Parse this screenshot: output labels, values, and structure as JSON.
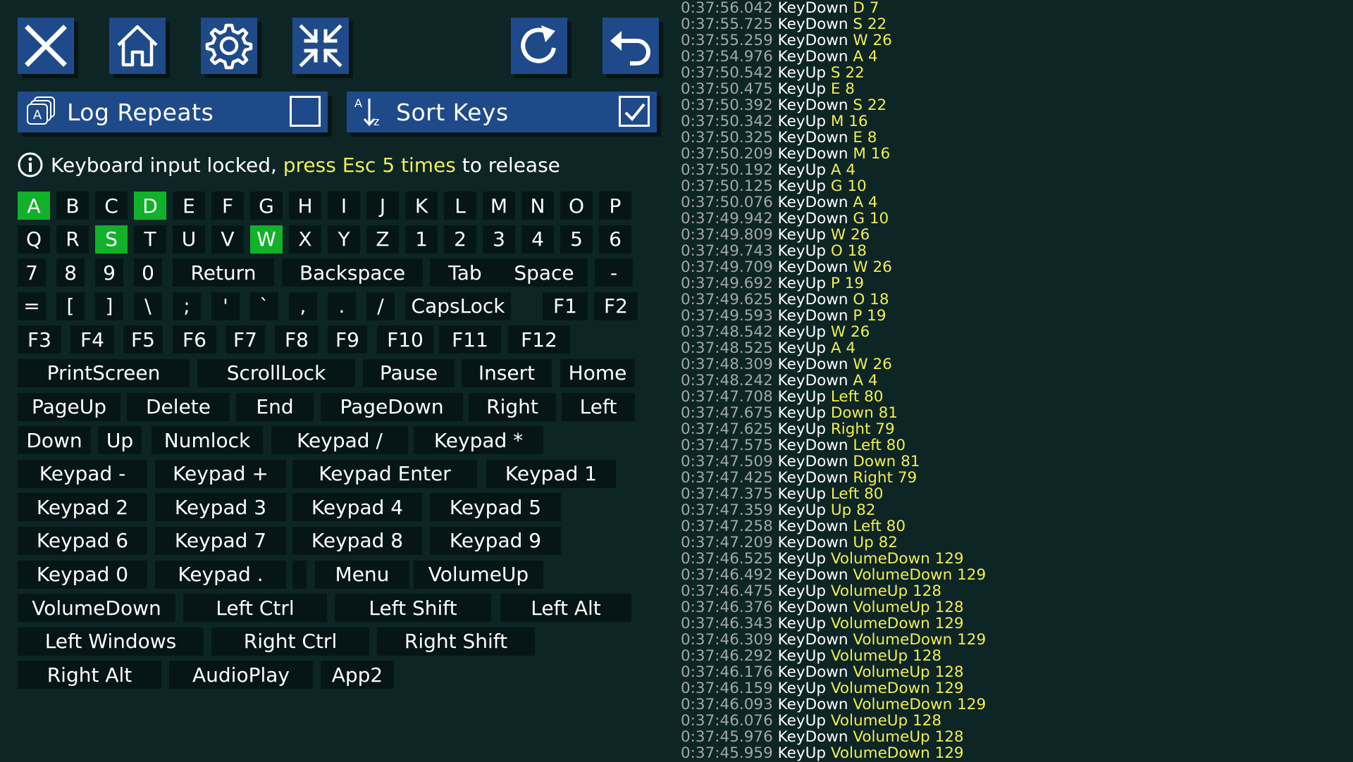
{
  "toolbar": [
    {
      "name": "close-button",
      "icon": "close-icon",
      "x": 0
    },
    {
      "name": "home-button",
      "icon": "home-icon",
      "x": 0
    },
    {
      "name": "settings-button",
      "icon": "gear-icon",
      "x": 0
    },
    {
      "name": "minimize-button",
      "icon": "collapse-icon",
      "x": 0
    },
    {
      "name": "reload-button",
      "icon": "redo-icon",
      "x": 0
    },
    {
      "name": "back-button",
      "icon": "undo-icon",
      "x": 0
    }
  ],
  "toggles": {
    "log_repeats": {
      "label": "Log Repeats",
      "checked": false,
      "icon": "keys-stack-icon"
    },
    "sort_keys": {
      "label": "Sort Keys",
      "checked": true,
      "icon": "sort-az-icon"
    }
  },
  "info": {
    "icon": "info-icon",
    "prefix": "Keyboard input locked, ",
    "highlight": "press Esc 5 times",
    "suffix": " to release"
  },
  "keyboard": {
    "rows": [
      [
        {
          "label": "A",
          "down": true
        },
        {
          "label": "B"
        },
        {
          "label": "C"
        },
        {
          "label": "D",
          "down": true
        },
        {
          "label": "E"
        },
        {
          "label": "F"
        },
        {
          "label": "G"
        },
        {
          "label": "H"
        },
        {
          "label": "I"
        },
        {
          "label": "J"
        },
        {
          "label": "K"
        },
        {
          "label": "L"
        },
        {
          "label": "M"
        },
        {
          "label": "N"
        },
        {
          "label": "O"
        },
        {
          "label": "P"
        }
      ],
      [
        {
          "label": "Q"
        },
        {
          "label": "R"
        },
        {
          "label": "S",
          "down": true
        },
        {
          "label": "T"
        },
        {
          "label": "U"
        },
        {
          "label": "V"
        },
        {
          "label": "W",
          "down": true
        },
        {
          "label": "X"
        },
        {
          "label": "Y"
        },
        {
          "label": "Z"
        },
        {
          "label": "1"
        },
        {
          "label": "2"
        },
        {
          "label": "3"
        },
        {
          "label": "4"
        },
        {
          "label": "5"
        },
        {
          "label": "6"
        }
      ],
      [
        {
          "label": "7"
        },
        {
          "label": "8"
        },
        {
          "label": "9"
        },
        {
          "label": "0"
        },
        {
          "label": "Return"
        },
        {
          "label": "Backspace"
        },
        {
          "label": "Tab"
        },
        {
          "label": "Space"
        },
        {
          "label": "-"
        }
      ],
      [
        {
          "label": "="
        },
        {
          "label": "["
        },
        {
          "label": "]"
        },
        {
          "label": "\\"
        },
        {
          "label": ";"
        },
        {
          "label": "'"
        },
        {
          "label": "`"
        },
        {
          "label": ","
        },
        {
          "label": "."
        },
        {
          "label": "/"
        },
        {
          "label": "CapsLock"
        },
        {
          "label": "F1"
        },
        {
          "label": "F2"
        }
      ],
      [
        {
          "label": "F3"
        },
        {
          "label": "F4"
        },
        {
          "label": "F5"
        },
        {
          "label": "F6"
        },
        {
          "label": "F7"
        },
        {
          "label": "F8"
        },
        {
          "label": "F9"
        },
        {
          "label": "F10"
        },
        {
          "label": "F11"
        },
        {
          "label": "F12"
        }
      ],
      [
        {
          "label": "PrintScreen"
        },
        {
          "label": "ScrollLock"
        },
        {
          "label": "Pause"
        },
        {
          "label": "Insert"
        },
        {
          "label": "Home"
        }
      ],
      [
        {
          "label": "PageUp"
        },
        {
          "label": "Delete"
        },
        {
          "label": "End"
        },
        {
          "label": "PageDown"
        },
        {
          "label": "Right"
        },
        {
          "label": "Left"
        }
      ],
      [
        {
          "label": "Down"
        },
        {
          "label": "Up"
        },
        {
          "label": "Numlock"
        },
        {
          "label": "Keypad /"
        },
        {
          "label": "Keypad *"
        }
      ],
      [
        {
          "label": "Keypad -"
        },
        {
          "label": "Keypad +"
        },
        {
          "label": "Keypad Enter"
        },
        {
          "label": "Keypad 1"
        }
      ],
      [
        {
          "label": "Keypad 2"
        },
        {
          "label": "Keypad 3"
        },
        {
          "label": "Keypad 4"
        },
        {
          "label": "Keypad 5"
        }
      ],
      [
        {
          "label": "Keypad 6"
        },
        {
          "label": "Keypad 7"
        },
        {
          "label": "Keypad 8"
        },
        {
          "label": "Keypad 9"
        }
      ],
      [
        {
          "label": "Keypad 0"
        },
        {
          "label": "Keypad ."
        },
        {
          "label": ""
        },
        {
          "label": "Menu"
        },
        {
          "label": "VolumeUp"
        }
      ],
      [
        {
          "label": "VolumeDown"
        },
        {
          "label": "Left Ctrl"
        },
        {
          "label": "Left Shift"
        },
        {
          "label": "Left Alt"
        }
      ],
      [
        {
          "label": "Left Windows"
        },
        {
          "label": "Right Ctrl"
        },
        {
          "label": "Right Shift"
        }
      ],
      [
        {
          "label": "Right Alt"
        },
        {
          "label": "AudioPlay"
        },
        {
          "label": "App2"
        }
      ]
    ]
  },
  "log": [
    {
      "time": "0:37:56.042",
      "event": "KeyDown",
      "key": "D",
      "code": "7"
    },
    {
      "time": "0:37:55.725",
      "event": "KeyDown",
      "key": "S",
      "code": "22"
    },
    {
      "time": "0:37:55.259",
      "event": "KeyDown",
      "key": "W",
      "code": "26"
    },
    {
      "time": "0:37:54.976",
      "event": "KeyDown",
      "key": "A",
      "code": "4"
    },
    {
      "time": "0:37:50.542",
      "event": "KeyUp",
      "key": "S",
      "code": "22"
    },
    {
      "time": "0:37:50.475",
      "event": "KeyUp",
      "key": "E",
      "code": "8"
    },
    {
      "time": "0:37:50.392",
      "event": "KeyDown",
      "key": "S",
      "code": "22"
    },
    {
      "time": "0:37:50.342",
      "event": "KeyUp",
      "key": "M",
      "code": "16"
    },
    {
      "time": "0:37:50.325",
      "event": "KeyDown",
      "key": "E",
      "code": "8"
    },
    {
      "time": "0:37:50.209",
      "event": "KeyDown",
      "key": "M",
      "code": "16"
    },
    {
      "time": "0:37:50.192",
      "event": "KeyUp",
      "key": "A",
      "code": "4"
    },
    {
      "time": "0:37:50.125",
      "event": "KeyUp",
      "key": "G",
      "code": "10"
    },
    {
      "time": "0:37:50.076",
      "event": "KeyDown",
      "key": "A",
      "code": "4"
    },
    {
      "time": "0:37:49.942",
      "event": "KeyDown",
      "key": "G",
      "code": "10"
    },
    {
      "time": "0:37:49.809",
      "event": "KeyUp",
      "key": "W",
      "code": "26"
    },
    {
      "time": "0:37:49.743",
      "event": "KeyUp",
      "key": "O",
      "code": "18"
    },
    {
      "time": "0:37:49.709",
      "event": "KeyDown",
      "key": "W",
      "code": "26"
    },
    {
      "time": "0:37:49.692",
      "event": "KeyUp",
      "key": "P",
      "code": "19"
    },
    {
      "time": "0:37:49.625",
      "event": "KeyDown",
      "key": "O",
      "code": "18"
    },
    {
      "time": "0:37:49.593",
      "event": "KeyDown",
      "key": "P",
      "code": "19"
    },
    {
      "time": "0:37:48.542",
      "event": "KeyUp",
      "key": "W",
      "code": "26"
    },
    {
      "time": "0:37:48.525",
      "event": "KeyUp",
      "key": "A",
      "code": "4"
    },
    {
      "time": "0:37:48.309",
      "event": "KeyDown",
      "key": "W",
      "code": "26"
    },
    {
      "time": "0:37:48.242",
      "event": "KeyDown",
      "key": "A",
      "code": "4"
    },
    {
      "time": "0:37:47.708",
      "event": "KeyUp",
      "key": "Left",
      "code": "80"
    },
    {
      "time": "0:37:47.675",
      "event": "KeyUp",
      "key": "Down",
      "code": "81"
    },
    {
      "time": "0:37:47.625",
      "event": "KeyUp",
      "key": "Right",
      "code": "79"
    },
    {
      "time": "0:37:47.575",
      "event": "KeyDown",
      "key": "Left",
      "code": "80"
    },
    {
      "time": "0:37:47.509",
      "event": "KeyDown",
      "key": "Down",
      "code": "81"
    },
    {
      "time": "0:37:47.425",
      "event": "KeyDown",
      "key": "Right",
      "code": "79"
    },
    {
      "time": "0:37:47.375",
      "event": "KeyUp",
      "key": "Left",
      "code": "80"
    },
    {
      "time": "0:37:47.359",
      "event": "KeyUp",
      "key": "Up",
      "code": "82"
    },
    {
      "time": "0:37:47.258",
      "event": "KeyDown",
      "key": "Left",
      "code": "80"
    },
    {
      "time": "0:37:47.209",
      "event": "KeyDown",
      "key": "Up",
      "code": "82"
    },
    {
      "time": "0:37:46.525",
      "event": "KeyUp",
      "key": "VolumeDown",
      "code": "129"
    },
    {
      "time": "0:37:46.492",
      "event": "KeyDown",
      "key": "VolumeDown",
      "code": "129"
    },
    {
      "time": "0:37:46.475",
      "event": "KeyUp",
      "key": "VolumeUp",
      "code": "128"
    },
    {
      "time": "0:37:46.376",
      "event": "KeyDown",
      "key": "VolumeUp",
      "code": "128"
    },
    {
      "time": "0:37:46.343",
      "event": "KeyUp",
      "key": "VolumeDown",
      "code": "129"
    },
    {
      "time": "0:37:46.309",
      "event": "KeyDown",
      "key": "VolumeDown",
      "code": "129"
    },
    {
      "time": "0:37:46.292",
      "event": "KeyUp",
      "key": "VolumeUp",
      "code": "128"
    },
    {
      "time": "0:37:46.176",
      "event": "KeyDown",
      "key": "VolumeUp",
      "code": "128"
    },
    {
      "time": "0:37:46.159",
      "event": "KeyUp",
      "key": "VolumeDown",
      "code": "129"
    },
    {
      "time": "0:37:46.093",
      "event": "KeyDown",
      "key": "VolumeDown",
      "code": "129"
    },
    {
      "time": "0:37:46.076",
      "event": "KeyUp",
      "key": "VolumeUp",
      "code": "128"
    },
    {
      "time": "0:37:45.976",
      "event": "KeyDown",
      "key": "VolumeUp",
      "code": "128"
    },
    {
      "time": "0:37:45.959",
      "event": "KeyUp",
      "key": "VolumeDown",
      "code": "129"
    }
  ],
  "colors": {
    "background": "#0e2525",
    "button": "#1f4a8a",
    "key": "#061616",
    "key_down": "#11b12a",
    "highlight": "#f1ee4f"
  }
}
